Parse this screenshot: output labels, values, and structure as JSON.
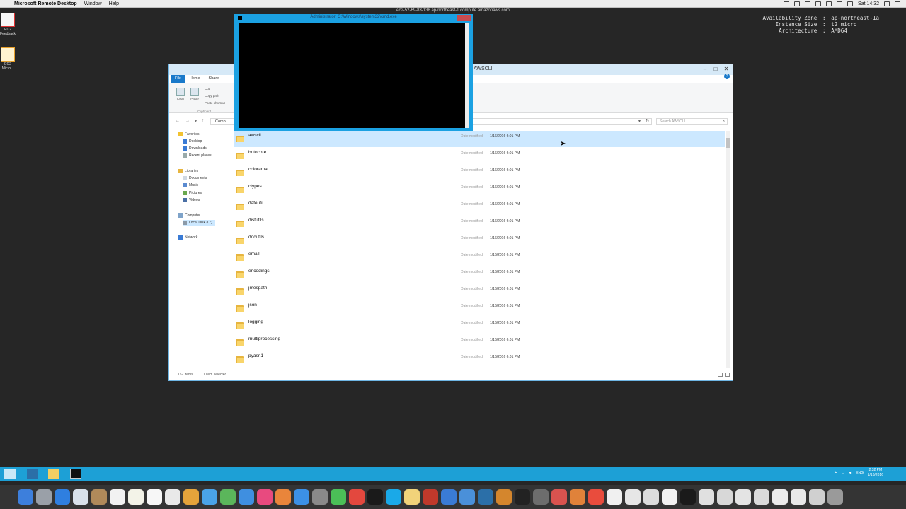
{
  "mac_menubar": {
    "apple_glyph": "",
    "app_name": "Microsoft Remote Desktop",
    "menus": [
      "Window",
      "Help"
    ],
    "clock": "Sat 14:32"
  },
  "remote_title": "ec2-52-69-83-138.ap-northeast-1.compute.amazonaws.com",
  "instance_info": [
    {
      "key": "Availability Zone",
      "value": "ap-northeast-1a"
    },
    {
      "key": "Instance Size",
      "value": "t2.micro"
    },
    {
      "key": "Architecture",
      "value": "AMD64"
    }
  ],
  "instance_sep": ":",
  "desktop_icons": [
    {
      "label": "EC2 Feedback"
    },
    {
      "label": "EC2 Micro..."
    }
  ],
  "explorer": {
    "title": "AWSCLI",
    "window_controls": {
      "minimize": "–",
      "maximize": "□",
      "close": "✕"
    },
    "ribbon_tabs": [
      "File",
      "Home",
      "Share"
    ],
    "ribbon": {
      "copy": "Copy",
      "paste": "Paste",
      "cut": "Cut",
      "copy_path": "Copy path",
      "paste_shortcut": "Paste shortcut",
      "group_label": "Clipboard",
      "help": "?"
    },
    "nav": {
      "back": "←",
      "forward": "→",
      "dropdown": "▾",
      "up": "↑"
    },
    "address": "Comp",
    "address_dropdown": "▾",
    "refresh": "↻",
    "search_placeholder": "Search AWSCLI",
    "search_glyph": "⌕",
    "nav_pane": [
      {
        "label": "Favorites"
      },
      {
        "label": "Desktop"
      },
      {
        "label": "Downloads"
      },
      {
        "label": "Recent places"
      },
      {
        "label": "Libraries"
      },
      {
        "label": "Documents"
      },
      {
        "label": "Music"
      },
      {
        "label": "Pictures"
      },
      {
        "label": "Videos"
      },
      {
        "label": "Computer"
      },
      {
        "label": "Local Disk (C:)"
      },
      {
        "label": "Network"
      }
    ],
    "date_label": "Date modified:",
    "files": [
      {
        "name": "awscli",
        "date": "1/16/2016 6:01 PM"
      },
      {
        "name": "botocore",
        "date": "1/16/2016 6:01 PM"
      },
      {
        "name": "colorama",
        "date": "1/16/2016 6:01 PM"
      },
      {
        "name": "ctypes",
        "date": "1/16/2016 6:01 PM"
      },
      {
        "name": "dateutil",
        "date": "1/16/2016 6:01 PM"
      },
      {
        "name": "distutils",
        "date": "1/16/2016 6:01 PM"
      },
      {
        "name": "docutils",
        "date": "1/16/2016 6:01 PM"
      },
      {
        "name": "email",
        "date": "1/16/2016 6:01 PM"
      },
      {
        "name": "encodings",
        "date": "1/16/2016 6:01 PM"
      },
      {
        "name": "jmespath",
        "date": "1/16/2016 6:01 PM"
      },
      {
        "name": "json",
        "date": "1/16/2016 6:01 PM"
      },
      {
        "name": "logging",
        "date": "1/16/2016 6:01 PM"
      },
      {
        "name": "multiprocessing",
        "date": "1/16/2016 6:01 PM"
      },
      {
        "name": "pyasn1",
        "date": "1/16/2016 6:01 PM"
      }
    ],
    "status_items": "152 items",
    "status_selected": "1 item selected"
  },
  "cmd_window": {
    "title": "Administrator: C:\\Windows\\system32\\cmd.exe"
  },
  "win_taskbar": {
    "tray_lang": "ENG",
    "time": "2:32 PM",
    "date": "1/16/2016"
  },
  "colors": {
    "explorer_border": "#6fb6e4",
    "selection": "#cce8ff",
    "folder": "#f9d56b",
    "taskbar": "#1da0d6",
    "cmd_border": "#1ba1e2"
  }
}
